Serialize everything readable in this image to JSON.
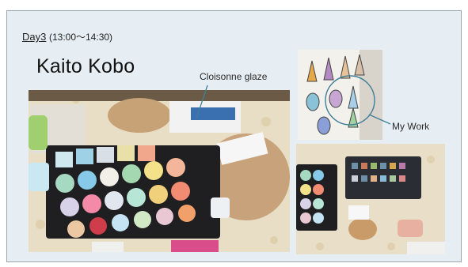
{
  "slide": {
    "day_label": "Day3",
    "time": "(13:00～14:30)",
    "title": "Kaito Kobo"
  },
  "annotations": {
    "cloisonne": "Cloisonne glaze",
    "my_work": "My Work"
  },
  "colors": {
    "frame_bg": "#e6eef4",
    "callout_line": "#3f7f98",
    "tray": "#1f1f22",
    "table_cloth": "#e8ddc5"
  }
}
